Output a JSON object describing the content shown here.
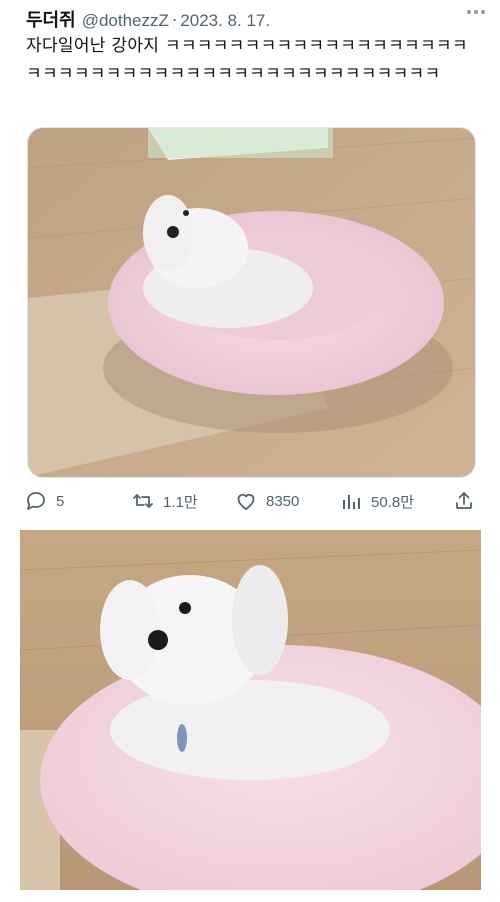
{
  "tweet": {
    "display_name": "두더쥐",
    "handle": "@dothezzZ",
    "separator": "·",
    "date": "2023. 8. 17.",
    "text": "자다일어난 강아지 ㅋㅋㅋㅋㅋㅋㅋㅋㅋㅋㅋㅋㅋㅋㅋㅋㅋㅋㅋㅋㅋㅋㅋㅋㅋㅋㅋㅋㅋㅋㅋㅋㅋㅋㅋㅋㅋㅋㅋㅋㅋㅋㅋㅋㅋ"
  },
  "actions": {
    "replies": "5",
    "retweets": "1.1만",
    "likes": "8350",
    "views": "50.8만"
  },
  "icons": {
    "more": "more-options-icon",
    "reply": "reply-bubble-icon",
    "retweet": "retweet-arrows-icon",
    "like": "heart-icon",
    "views": "bar-chart-views-icon",
    "share": "share-upload-icon"
  },
  "colors": {
    "text": "#0f1419",
    "muted": "#536471",
    "bed_pink": "#f3d3de",
    "floor": "#c8a887"
  }
}
